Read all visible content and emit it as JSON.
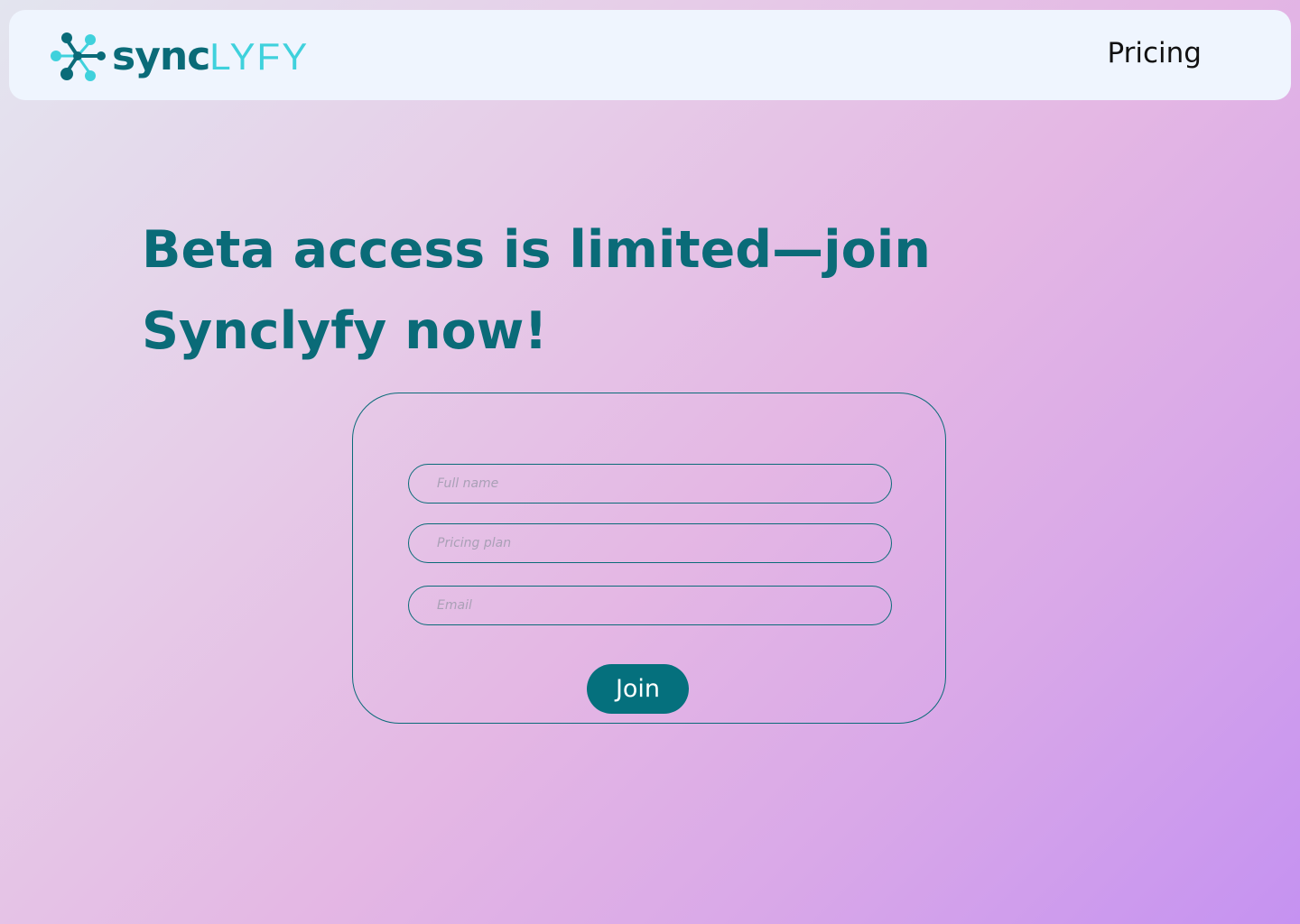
{
  "header": {
    "logo": {
      "bold_text": "sync",
      "light_text": "LYFY",
      "icon": "molecule-icon",
      "colors": {
        "dark": "#0a6b78",
        "light": "#3fd1dc"
      }
    },
    "nav": {
      "pricing_label": "Pricing"
    }
  },
  "hero": {
    "headline": "Beta access is limited—join Synclyfy now!"
  },
  "form": {
    "full_name": {
      "placeholder": "Full name",
      "value": ""
    },
    "pricing_plan": {
      "placeholder": "Pricing plan",
      "value": ""
    },
    "email": {
      "placeholder": "Email",
      "value": ""
    },
    "submit_label": "Join"
  },
  "theme": {
    "accent": "#0a6b78",
    "button": "#05707d",
    "header_bg": "#eff5fe"
  }
}
